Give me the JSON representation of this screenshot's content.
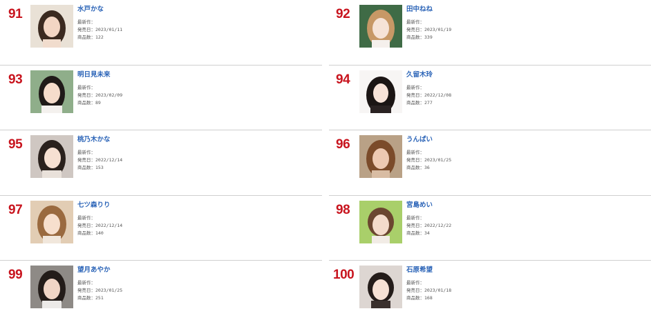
{
  "labels": {
    "latest": "最新作：",
    "release_prefix": "発売日：",
    "count_prefix": "商品数："
  },
  "colors": {
    "rank": "#c8141e",
    "name_link": "#2a63b7",
    "divider": "#cfcfcf"
  },
  "entries": [
    {
      "rank": "91",
      "name": "水戸かな",
      "release": "2023/01/11",
      "count": "122"
    },
    {
      "rank": "92",
      "name": "田中ねね",
      "release": "2023/01/19",
      "count": "339"
    },
    {
      "rank": "93",
      "name": "明日見未来",
      "release": "2023/02/09",
      "count": "89"
    },
    {
      "rank": "94",
      "name": "久留木玲",
      "release": "2022/12/08",
      "count": "277"
    },
    {
      "rank": "95",
      "name": "桃乃木かな",
      "release": "2022/12/14",
      "count": "153"
    },
    {
      "rank": "96",
      "name": "うんぱい",
      "release": "2023/01/25",
      "count": "36"
    },
    {
      "rank": "97",
      "name": "七ツ森りり",
      "release": "2022/12/14",
      "count": "140"
    },
    {
      "rank": "98",
      "name": "宮島めい",
      "release": "2022/12/22",
      "count": "34"
    },
    {
      "rank": "99",
      "name": "望月あやか",
      "release": "2023/01/25",
      "count": "251"
    },
    {
      "rank": "100",
      "name": "石原希望",
      "release": "2023/01/18",
      "count": "168"
    }
  ]
}
